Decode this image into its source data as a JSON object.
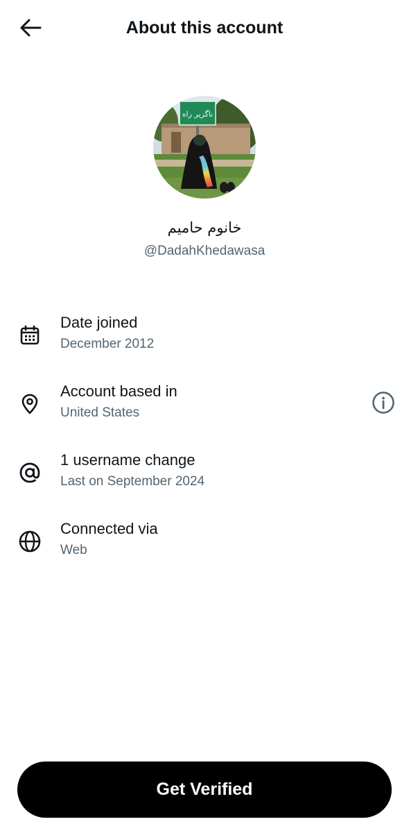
{
  "header": {
    "title": "About this account",
    "back_icon": "arrow-left-icon"
  },
  "profile": {
    "display_name": "خانوم حامیم",
    "handle": "@DadahKhedawasa",
    "avatar_sign_text": "ناگزیر راه"
  },
  "details": [
    {
      "icon": "calendar-icon",
      "label": "Date joined",
      "value": "December 2012"
    },
    {
      "icon": "location-pin-icon",
      "label": "Account based in",
      "value": "United States",
      "action_icon": "info-icon"
    },
    {
      "icon": "at-sign-icon",
      "label": "1 username change",
      "value": "Last on September 2024"
    },
    {
      "icon": "globe-icon",
      "label": "Connected via",
      "value": "Web"
    }
  ],
  "footer": {
    "verify_label": "Get Verified"
  },
  "colors": {
    "primary_text": "#0f1419",
    "secondary_text": "#536471",
    "button_bg": "#000000",
    "button_text": "#ffffff"
  }
}
